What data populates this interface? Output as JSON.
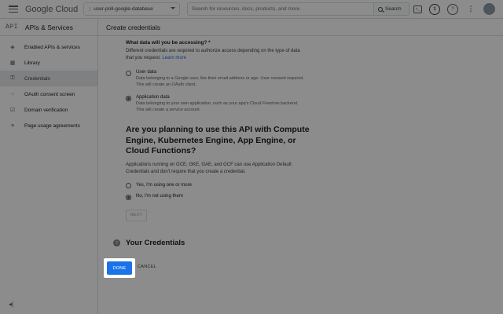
{
  "topbar": {
    "logo": "Google Cloud",
    "project": "user-poll-google-database",
    "search_placeholder": "Search for resources, docs, products, and more",
    "search_button": "Search",
    "terminal_glyph": ">_",
    "notification_count": "1",
    "help_glyph": "?",
    "more_glyph": "⋮"
  },
  "sidebar": {
    "api_label": "API",
    "title": "APIs & Services",
    "items": [
      {
        "label": "Enabled APIs & services",
        "icon": "diamond-icon",
        "glyph": "◈"
      },
      {
        "label": "Library",
        "icon": "library-icon",
        "glyph": "▦"
      },
      {
        "label": "Credentials",
        "icon": "key-icon",
        "glyph": "⚿"
      },
      {
        "label": "OAuth consent screen",
        "icon": "consent-icon",
        "glyph": "⁘"
      },
      {
        "label": "Domain verification",
        "icon": "checkbox-icon",
        "glyph": "☑"
      },
      {
        "label": "Page usage agreements",
        "icon": "settings-list-icon",
        "glyph": "≡"
      }
    ],
    "collapse_glyph": "◂|"
  },
  "main": {
    "header": "Create credentials",
    "question1": "What data will you be accessing? *",
    "question1_help": "Different credentials are required to authorize access depending on the type of data that you request.",
    "learn_more": "Learn more",
    "options1": [
      {
        "label": "User data",
        "desc": "Data belonging to a Google user, like their email address or age. User consent required. This will create an OAuth client.",
        "selected": false
      },
      {
        "label": "Application data",
        "desc": "Data belonging to your own application, such as your app's Cloud Firestore backend. This will create a service account.",
        "selected": true
      }
    ],
    "question2": "Are you planning to use this API with Compute Engine, Kubernetes Engine, App Engine, or Cloud Functions?",
    "question2_help": "Applications running on GCE, GKE, GAE, and GCF can use Application Default Credentials and don't require that you create a credential.",
    "options2": [
      {
        "label": "Yes, I'm using one or more",
        "selected": false
      },
      {
        "label": "No, I'm not using them",
        "selected": true
      }
    ],
    "next_label": "NEXT",
    "step_number": "2",
    "step_title": "Your Credentials",
    "done_label": "DONE",
    "cancel_label": "CANCEL"
  },
  "colors": {
    "accent": "#1a73e8",
    "overlay": "rgba(0,0,0,0.45)"
  }
}
